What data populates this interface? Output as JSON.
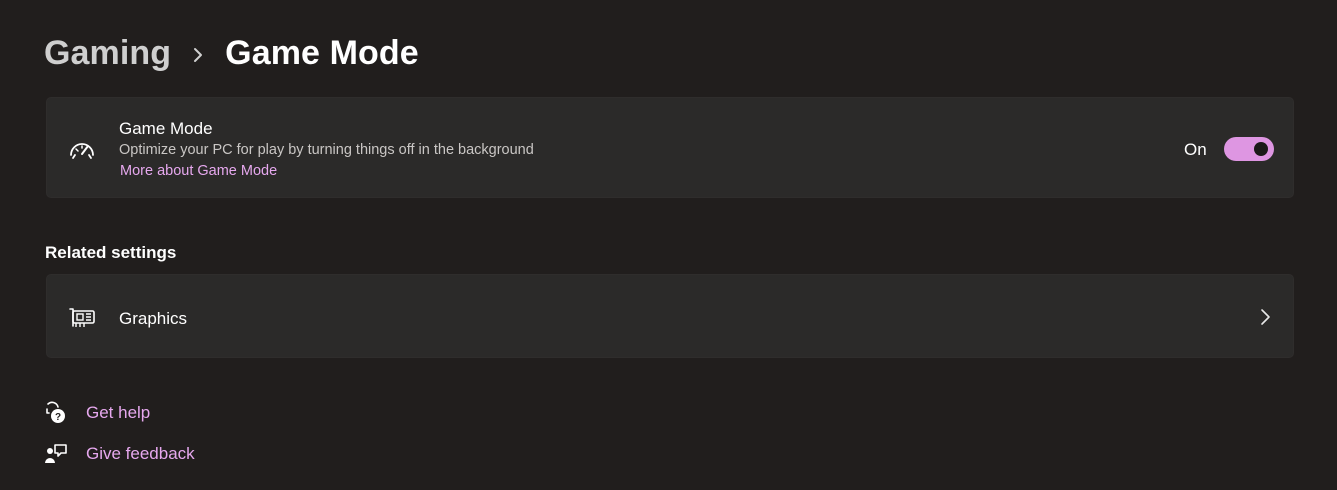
{
  "breadcrumb": {
    "parent": "Gaming",
    "current": "Game Mode"
  },
  "game_mode_card": {
    "icon": "speedometer-icon",
    "title": "Game Mode",
    "description": "Optimize your PC for play by turning things off in the background",
    "link": "More about Game Mode",
    "toggle_state_label": "On",
    "toggle_on": true
  },
  "related_settings": {
    "title": "Related settings",
    "items": [
      {
        "label": "Graphics",
        "icon": "graphics-card-icon"
      }
    ]
  },
  "footer_links": {
    "help": {
      "label": "Get help",
      "icon": "help-chat-icon"
    },
    "feedback": {
      "label": "Give feedback",
      "icon": "feedback-icon"
    }
  },
  "colors": {
    "background": "#211e1d",
    "card": "#2b2a29",
    "accent": "#de96e2",
    "link": "#e6a8ee"
  }
}
